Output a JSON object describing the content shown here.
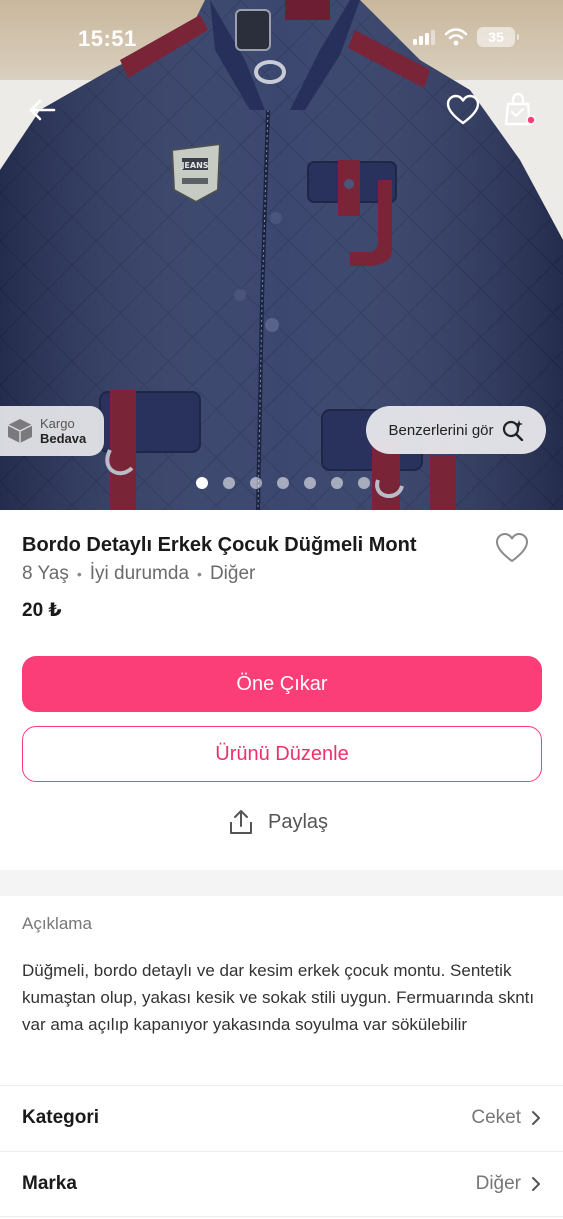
{
  "status_bar": {
    "time": "15:51",
    "battery": "35"
  },
  "hero": {
    "kargo_badge": {
      "top": "Kargo",
      "bottom": "Bedava"
    },
    "similar_button": "Benzerlerini gör",
    "photo_count": 7,
    "active_photo": 1,
    "badge_text": "JEANS"
  },
  "product": {
    "title": "Bordo Detaylı Erkek Çocuk Düğmeli Mont",
    "size": "8 Yaş",
    "condition": "İyi durumda",
    "brand": "Diğer",
    "separator": "•",
    "price": "20 ₺"
  },
  "actions": {
    "primary": "Öne Çıkar",
    "secondary": "Ürünü Düzenle",
    "share": "Paylaş"
  },
  "description": {
    "heading": "Açıklama",
    "text": "Düğmeli, bordo detaylı ve dar kesim erkek çocuk montu. Sentetik kumaştan olup, yakası kesik ve sokak stili uygun. Fermuarında skntı var ama açılıp kapanıyor yakasında soyulma var sökülebilir"
  },
  "details": [
    {
      "label": "Kategori",
      "value": "Ceket"
    },
    {
      "label": "Marka",
      "value": "Diğer"
    }
  ],
  "colors": {
    "accent": "#fc3e78",
    "jacket": "#2f3b66",
    "trim": "#7a2438"
  }
}
